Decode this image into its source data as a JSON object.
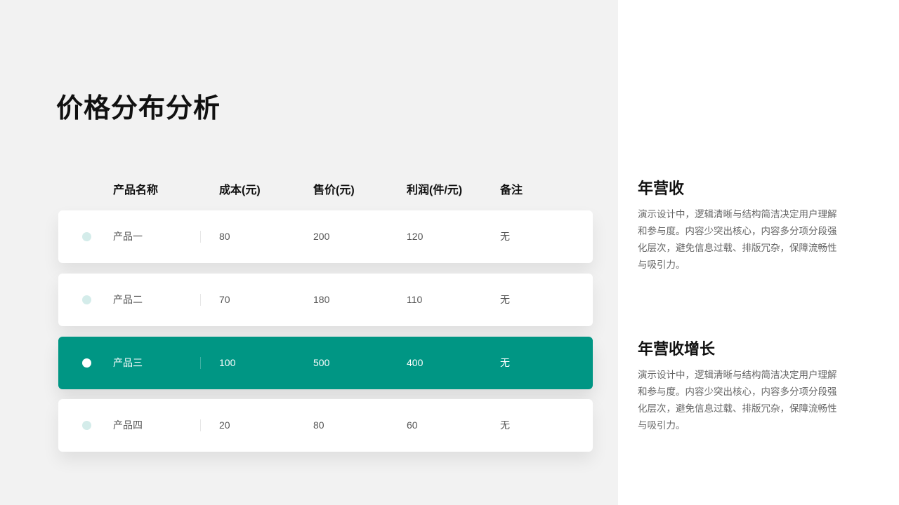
{
  "title": "价格分布分析",
  "table": {
    "headers": [
      "产品名称",
      "成本(元)",
      "售价(元)",
      "利润(件/元)",
      "备注"
    ],
    "rows": [
      {
        "cells": [
          "产品一",
          "80",
          "200",
          "120",
          "无"
        ],
        "highlighted": false
      },
      {
        "cells": [
          "产品二",
          "70",
          "180",
          "110",
          "无"
        ],
        "highlighted": false
      },
      {
        "cells": [
          "产品三",
          "100",
          "500",
          "400",
          "无"
        ],
        "highlighted": true
      },
      {
        "cells": [
          "产品四",
          "20",
          "80",
          "60",
          "无"
        ],
        "highlighted": false
      }
    ]
  },
  "sections": [
    {
      "title": "年营收",
      "body": "演示设计中，逻辑清晰与结构简洁决定用户理解和参与度。内容少突出核心，内容多分项分段强化层次，避免信息过载、排版冗杂，保障流畅性与吸引力。"
    },
    {
      "title": "年营收增长",
      "body": "演示设计中，逻辑清晰与结构简洁决定用户理解和参与度。内容少突出核心，内容多分项分段强化层次，避免信息过载、排版冗杂，保障流畅性与吸引力。"
    }
  ],
  "colors": {
    "accent": "#009684",
    "dot_light": "#d4ecea",
    "left_background": "#f2f2f2"
  }
}
